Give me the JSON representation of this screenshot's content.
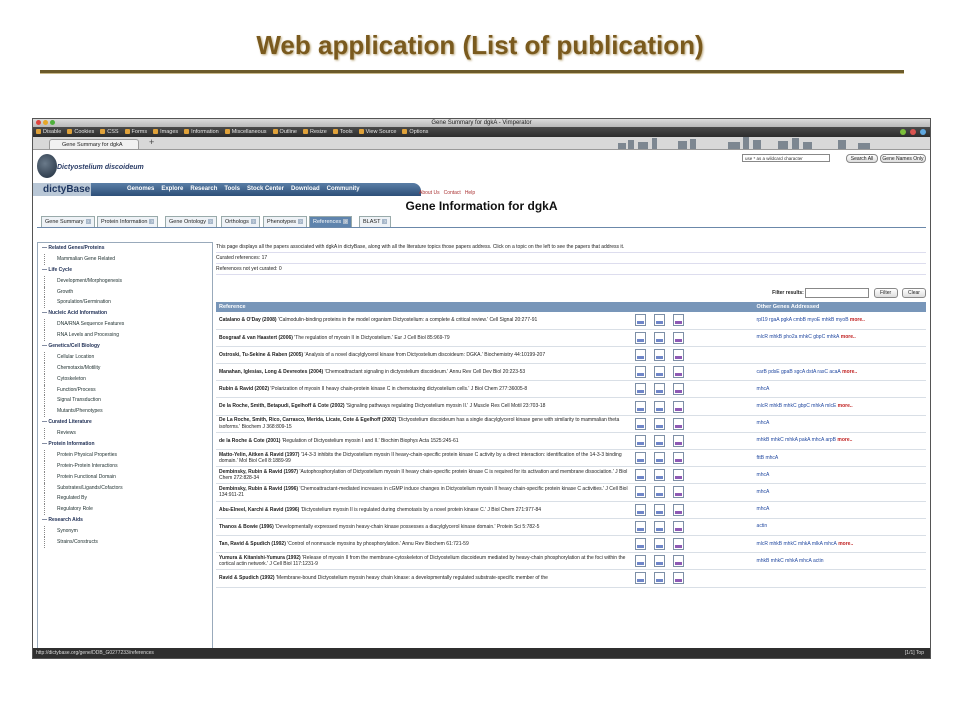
{
  "slide": {
    "title": "Web application (List of publication)"
  },
  "browser": {
    "window_title": "Gene Summary for dgkA - Vimperator",
    "toolbar_items": [
      "Disable",
      "Cookies",
      "CSS",
      "Forms",
      "Images",
      "Information",
      "Miscellaneous",
      "Outline",
      "Resize",
      "Tools",
      "View Source",
      "Options"
    ],
    "tab_label": "Gene Summary for dgkA",
    "tab_plus": "+",
    "status_url": "http://dictybase.org/gene/DDB_G0277233/references",
    "status_right": "[1/1]  Top"
  },
  "site": {
    "species": "Dictyostelium discoideum",
    "logo": "dictyBase",
    "nav": [
      "Genomes",
      "Explore",
      "Research",
      "Tools",
      "Stock Center",
      "Download",
      "Community"
    ],
    "top_links": [
      "About Us",
      "Contact",
      "Help"
    ],
    "search_placeholder": "use * as a wildcard character",
    "search_all_label": "Search All",
    "gene_names_only_label": "Gene Names Only"
  },
  "page": {
    "heading": "Gene Information for dgkA",
    "tabs": [
      "Gene Summary",
      "Protein Information",
      "Gene Ontology",
      "Orthologs",
      "Phenotypes",
      "References",
      "BLAST"
    ],
    "intro": "This page displays all the papers associated with dgkA in dictyBase, along with all the literature topics those papers address. Click on a topic on the left to see the papers that address it.",
    "curated": "Curated references: 17",
    "not_curated": "References not yet curated: 0",
    "filter_label": "Filter results:",
    "filter_button": "Filter",
    "clear_button": "Clear",
    "col_reference": "Reference",
    "col_other_genes": "Other Genes Addressed"
  },
  "sidebar": [
    {
      "label": "Related Genes/Proteins",
      "type": "cat"
    },
    {
      "label": "Mammalian Gene Related",
      "type": "sub"
    },
    {
      "label": "Life Cycle",
      "type": "cat"
    },
    {
      "label": "Development/Morphogenesis",
      "type": "sub"
    },
    {
      "label": "Growth",
      "type": "sub"
    },
    {
      "label": "Sporulation/Germination",
      "type": "sub"
    },
    {
      "label": "Nucleic Acid Information",
      "type": "cat"
    },
    {
      "label": "DNA/RNA Sequence Features",
      "type": "sub"
    },
    {
      "label": "RNA Levels and Processing",
      "type": "sub"
    },
    {
      "label": "Genetics/Cell Biology",
      "type": "cat"
    },
    {
      "label": "Cellular Location",
      "type": "sub"
    },
    {
      "label": "Chemotaxis/Motility",
      "type": "sub"
    },
    {
      "label": "Cytoskeleton",
      "type": "sub"
    },
    {
      "label": "Function/Process",
      "type": "sub"
    },
    {
      "label": "Signal Transduction",
      "type": "sub"
    },
    {
      "label": "Mutants/Phenotypes",
      "type": "sub"
    },
    {
      "label": "Curated Literature",
      "type": "cat"
    },
    {
      "label": "Reviews",
      "type": "sub"
    },
    {
      "label": "Protein Information",
      "type": "cat"
    },
    {
      "label": "Protein Physical Properties",
      "type": "sub"
    },
    {
      "label": "Protein-Protein Interactions",
      "type": "sub"
    },
    {
      "label": "Protein Functional Domain",
      "type": "sub"
    },
    {
      "label": "Substrates/Ligands/Cofactors",
      "type": "sub"
    },
    {
      "label": "Regulated By",
      "type": "sub"
    },
    {
      "label": "Regulatory Role",
      "type": "sub"
    },
    {
      "label": "Research Aids",
      "type": "cat"
    },
    {
      "label": "Synonym",
      "type": "sub"
    },
    {
      "label": "Strains/Constructs",
      "type": "sub"
    }
  ],
  "references": [
    {
      "authors": "Catalano & O'Day (2008)",
      "text": "'Calmodulin-binding proteins in the model organism Dictyostelium: a complete & critical review.' Cell Signal 20:277-91",
      "genes": "rpl19  rgaA  pgkA  cmbB  myoE  mhkB  myoB",
      "more": true
    },
    {
      "authors": "Bosgraaf & van Haastert (2006)",
      "text": "'The regulation of myosin II in Dictyostelium.' Eur J Cell Biol 85:969-79",
      "genes": "mlcR  mhkB  pho2a  mhkC  gbpC  mhkA",
      "more": true
    },
    {
      "authors": "Ostroski, Tu-Sekine & Raben (2005)",
      "text": "'Analysis of a novel diacylglycerol kinase from Dictyostelium discoideum: DGKA.' Biochemistry 44:10199-207",
      "genes": "",
      "more": false
    },
    {
      "authors": "Manahan, Iglesias, Long & Devreotes (2004)",
      "text": "'Chemoattractant signaling in dictyostelium discoideum.' Annu Rev Cell Dev Biol 20:223-53",
      "genes": "carB  pdsE  gpaB  sgcA  dstA  rasC  acaA",
      "more": true
    },
    {
      "authors": "Rubin & Ravid (2002)",
      "text": "'Polarization of myosin II heavy chain-protein kinase C in chemotaxing dictyostelium cells.' J Biol Chem 277:36005-8",
      "genes": "mhcA",
      "more": false
    },
    {
      "authors": "De la Roche, Smith, Betapudi, Egelhoff & Cote (2002)",
      "text": "'Signaling pathways regulating Dictyostelium myosin II.' J Muscle Res Cell Motil 23:703-18",
      "genes": "mlcR  mhkB  mhkC  gbpC  mhkA  mlcE",
      "more": true
    },
    {
      "authors": "De La Roche, Smith, Rico, Carrasco, Merida, Licate, Cote & Egelhoff (2002)",
      "text": "'Dictyostelium discoideum has a single diacylglycerol kinase gene with similarity to mammalian theta isoforms.' Biochem J 368:809-15",
      "genes": "mhcA",
      "more": false
    },
    {
      "authors": "de la Roche & Cote (2001)",
      "text": "'Regulation of Dictyostelium myosin I and II.' Biochim Biophys Acta 1525:245-61",
      "genes": "mhkB  mhkC  mhkA  pakA  mhcA  arpB",
      "more": true
    },
    {
      "authors": "Matto-Yelin, Aitken & Ravid (1997)",
      "text": "'14-3-3 inhibits the Dictyostelium myosin II heavy-chain-specific protein kinase C activity by a direct interaction: identification of the 14-3-3 binding domain.' Mol Biol Cell 8:1889-99",
      "genes": "fttB  mhcA",
      "more": false
    },
    {
      "authors": "Dembinsky, Rubin & Ravid (1997)",
      "text": "'Autophosphorylation of Dictyostelium myosin II heavy chain-specific protein kinase C is required for its activation and membrane dissociation.' J Biol Chem 272:828-34",
      "genes": "mhcA",
      "more": false
    },
    {
      "authors": "Dembinsky, Rubin & Ravid (1996)",
      "text": "'Chemoattractant-mediated increases in cGMP induce changes in Dictyostelium myosin II heavy chain-specific protein kinase C activities.' J Cell Biol 134:911-21",
      "genes": "mhcA",
      "more": false
    },
    {
      "authors": "Abu-Elneel, Karchi & Ravid (1996)",
      "text": "'Dictyostelium myosin II is regulated during chemotaxis by a novel protein kinase C.' J Biol Chem 271:977-84",
      "genes": "mhcA",
      "more": false
    },
    {
      "authors": "Thanos & Bowie (1996)",
      "text": "'Developmentally expressed myosin heavy-chain kinase possesses a diacylglycerol kinase domain.' Protein Sci 5:782-5",
      "genes": "actin",
      "more": false
    },
    {
      "authors": "Tan, Ravid & Spudich (1992)",
      "text": "'Control of nonmuscle myosins by phosphorylation.' Annu Rev Biochem 61:721-59",
      "genes": "mlcR  mhkB  mhkC  mhkA  mlkA  mhcA",
      "more": true
    },
    {
      "authors": "Yumura & Kitanishi-Yumura (1992)",
      "text": "'Release of myosin II from the membrane-cytoskeleton of Dictyostelium discoideum mediated by heavy-chain phosphorylation at the foci within the cortical actin network.' J Cell Biol 117:1231-9",
      "genes": "mhkB  mhkC  mhkA  mhcA  actin",
      "more": false
    },
    {
      "authors": "Ravid & Spudich (1992)",
      "text": "'Membrane-bound Dictyostelium myosin heavy chain kinase: a developmentally regulated substrate-specific member of the",
      "genes": "",
      "more": false
    }
  ],
  "more_label": "more..",
  "colors": {
    "nav_blue": "#2d4f78",
    "table_header": "#7896b9",
    "title_brown": "#7a5a1e"
  }
}
